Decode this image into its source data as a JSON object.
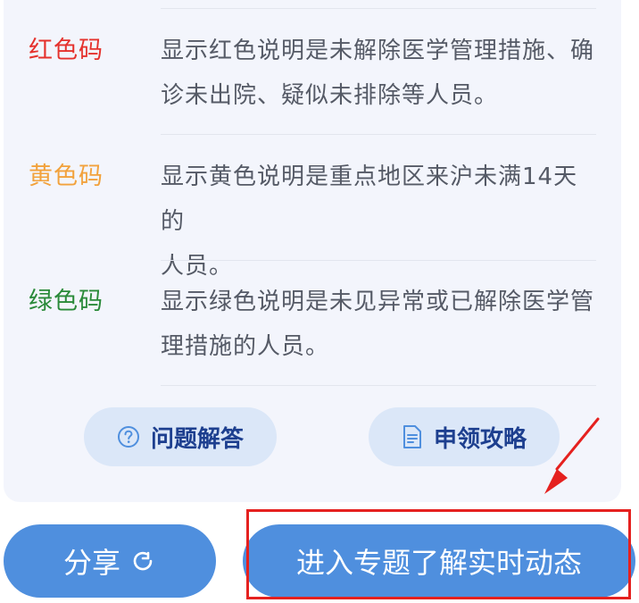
{
  "codes": [
    {
      "label": "红色码",
      "desc_line1": "显示红色说明是未解除医学管理措施、确",
      "desc_line2": "诊未出院、疑似未排除等人员。"
    },
    {
      "label": "黄色码",
      "desc_line1": "显示黄色说明是重点地区来沪未满14天的",
      "desc_line2": "人员。"
    },
    {
      "label": "绿色码",
      "desc_line1": "显示绿色说明是未见异常或已解除医学管",
      "desc_line2": "理措施的人员。"
    }
  ],
  "actions": {
    "faq_label": "问题解答",
    "guide_label": "申领攻略"
  },
  "bottom": {
    "share_label": "分享",
    "enter_label": "进入专题了解实时动态"
  },
  "colors": {
    "red": "#e5322d",
    "yellow": "#f2a23c",
    "green": "#2a8a39",
    "accent": "#4f8fde",
    "highlight": "#e5211f"
  }
}
